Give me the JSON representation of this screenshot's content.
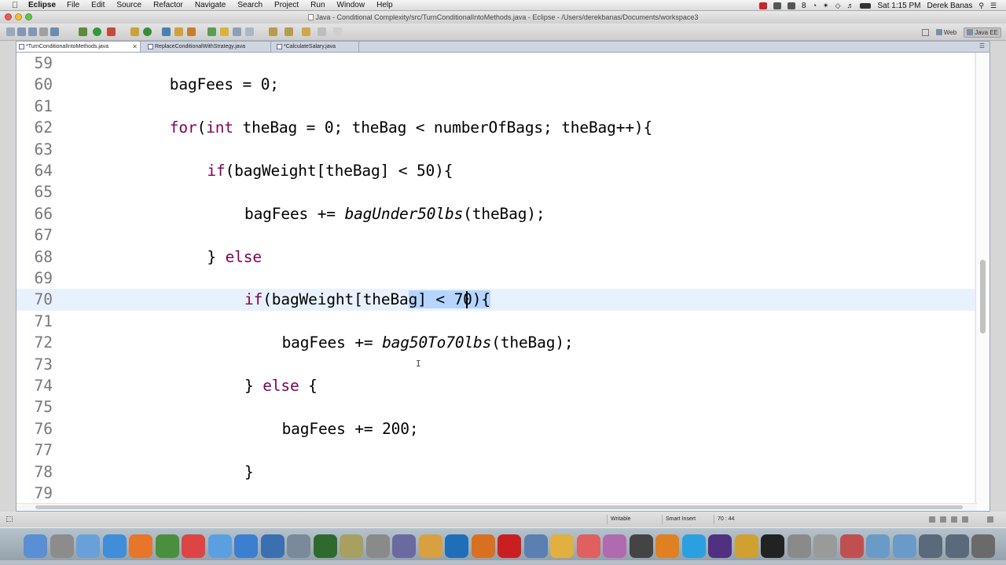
{
  "menubar": {
    "app_name": "Eclipse",
    "items": [
      "File",
      "Edit",
      "Source",
      "Refactor",
      "Navigate",
      "Search",
      "Project",
      "Run",
      "Window",
      "Help"
    ],
    "badge_count": "8",
    "clock": "Sat 1:15 PM",
    "user": "Derek Banas"
  },
  "window": {
    "title": "Java - Conditional Complexity/src/TurnConditionalIntoMethods.java - Eclipse - /Users/derekbanas/Documents/workspace3"
  },
  "perspectives": [
    "Web",
    "Java EE"
  ],
  "tabs": [
    {
      "label": "*TurnConditionalIntoMethods.java",
      "active": true
    },
    {
      "label": "ReplaceConditionalWithStrategy.java",
      "active": false
    },
    {
      "label": "*CalculateSalary.java",
      "active": false
    }
  ],
  "editor": {
    "lines": [
      {
        "num": "59"
      },
      {
        "num": "60",
        "parts": [
          {
            "t": "bagFees = 0;"
          }
        ]
      },
      {
        "num": "61"
      },
      {
        "num": "62",
        "parts": [
          {
            "t": "for",
            "c": "kw"
          },
          {
            "t": "("
          },
          {
            "t": "int",
            "c": "kw"
          },
          {
            "t": " theBag = 0; theBag < numberOfBags; theBag++){"
          }
        ]
      },
      {
        "num": "63"
      },
      {
        "num": "64",
        "parts": [
          {
            "t": "if",
            "c": "kw"
          },
          {
            "t": "(bagWeight[theBag] < 50){"
          }
        ]
      },
      {
        "num": "65"
      },
      {
        "num": "66",
        "parts": [
          {
            "t": "bagFees += "
          },
          {
            "t": "bagUnder50lbs",
            "c": "it"
          },
          {
            "t": "(theBag);"
          }
        ]
      },
      {
        "num": "67"
      },
      {
        "num": "68",
        "parts": [
          {
            "t": "} "
          },
          {
            "t": "else",
            "c": "kw"
          }
        ]
      },
      {
        "num": "69"
      },
      {
        "num": "70",
        "parts": [
          {
            "t": "if",
            "c": "kw"
          },
          {
            "t": "(bagWeight[theBa"
          },
          {
            "t": "g] < 70){",
            "c": "sel"
          }
        ]
      },
      {
        "num": "71"
      },
      {
        "num": "72",
        "parts": [
          {
            "t": "bagFees += "
          },
          {
            "t": "bag50To70lbs",
            "c": "it"
          },
          {
            "t": "(theBag);"
          }
        ]
      },
      {
        "num": "73"
      },
      {
        "num": "74",
        "parts": [
          {
            "t": "} "
          },
          {
            "t": "else",
            "c": "kw"
          },
          {
            "t": " {"
          }
        ]
      },
      {
        "num": "75"
      },
      {
        "num": "76",
        "parts": [
          {
            "t": "bagFees += 200;"
          }
        ]
      },
      {
        "num": "77"
      },
      {
        "num": "78",
        "parts": [
          {
            "t": "}"
          }
        ]
      },
      {
        "num": "79"
      }
    ],
    "current_line": "70"
  },
  "statusbar": {
    "writable": "Writable",
    "insert_mode": "Smart Insert",
    "position": "70 : 44"
  },
  "colors": {
    "keyword": "#7f0055",
    "current_line": "#e8f2fe",
    "selection": "#b5d5ff",
    "line_number": "#787878"
  },
  "dock": {
    "icons": [
      "finder-icon",
      "launchpad-icon",
      "preview-icon",
      "safari-icon",
      "firefox-icon",
      "chrome-icon",
      "calendar-icon",
      "itunes-icon",
      "app-store-icon",
      "quicktime-icon",
      "image-capture-icon",
      "camtasia-icon",
      "imovie-icon",
      "system-preferences-icon",
      "brushes-icon",
      "pages-icon",
      "photoshop-icon",
      "illustrator-icon",
      "acrobat-icon",
      "network-utility-icon",
      "stickies-icon",
      "text-edit-icon",
      "game-icon",
      "final-cut-icon",
      "vlc-icon",
      "skype-icon",
      "eclipse-icon",
      "app-icon",
      "terminal-icon",
      "calculator-icon",
      "grab-icon",
      "presentation-icon",
      "folder-icon",
      "folder-icon-2",
      "screen-icon",
      "screen-icon-2",
      "trash-icon"
    ]
  }
}
